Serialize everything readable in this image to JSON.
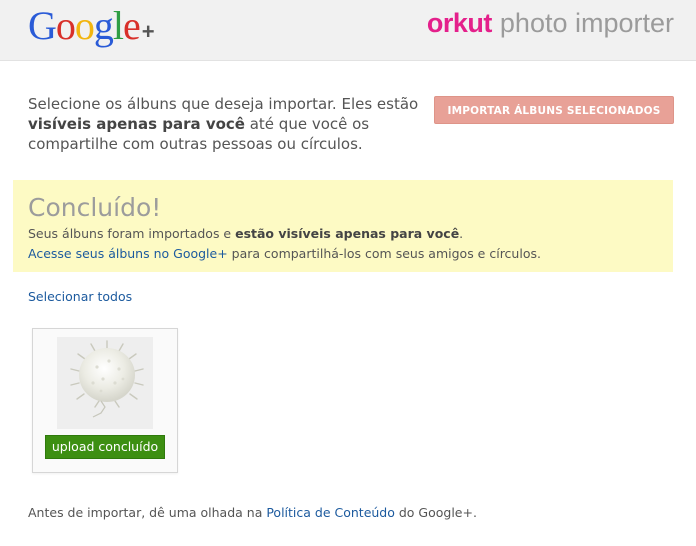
{
  "header": {
    "logo_letters": [
      "G",
      "o",
      "o",
      "g",
      "l",
      "e"
    ],
    "logo_plus": "+",
    "brand": "orkut",
    "product": "photo importer"
  },
  "intro": {
    "text_before": "Selecione os álbuns que deseja importar. Eles estão ",
    "text_bold": "visíveis apenas para você",
    "text_after": " até que você os compartilhe com outras pessoas ou círculos."
  },
  "import_button_label": "IMPORTAR ÁLBUNS SELECIONADOS",
  "notice": {
    "title": "Concluído!",
    "line1_before": "Seus álbuns foram importados e ",
    "line1_bold": "estão visíveis apenas para você",
    "line1_after": ".",
    "line2_link": "Acesse seus álbuns no Google+",
    "line2_after": " para compartilhá-los com seus amigos e círculos."
  },
  "select_all_label": "Selecionar todos",
  "album": {
    "status_label": "upload concluído"
  },
  "footer": {
    "before": "Antes de importar, dê uma olhada na ",
    "link": "Política de Conteúdo",
    "after": " do Google+."
  },
  "colors": {
    "orkut_pink": "#e4208b",
    "button_disabled": "#e8a197",
    "notice_bg": "#fdfac4",
    "link": "#1c5a9e",
    "success_green": "#3d8f12"
  }
}
